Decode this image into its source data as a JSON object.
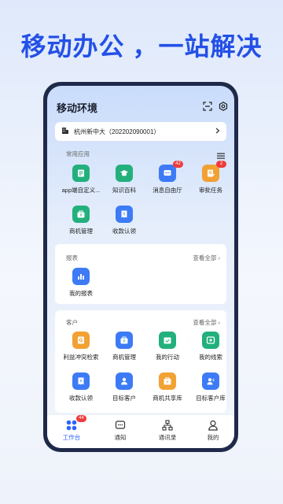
{
  "headline": "移动办公 ，一站解决",
  "app": {
    "title": "移动环境",
    "org": "杭州新中大（202202090001）"
  },
  "common": {
    "title": "常用应用",
    "items": [
      {
        "label": "app端自定义...",
        "color": "#22b07d",
        "icon": "form-icon"
      },
      {
        "label": "知识百科",
        "color": "#22b07d",
        "icon": "graduation-cap-icon"
      },
      {
        "label": "消息自由厅",
        "color": "#3d7bf6",
        "icon": "chat-icon",
        "badge": "42"
      },
      {
        "label": "审批任务",
        "color": "#f2a133",
        "icon": "document-edit-icon",
        "badge": "2"
      },
      {
        "label": "商机管理",
        "color": "#22b07d",
        "icon": "money-bag-icon"
      },
      {
        "label": "收款认领",
        "color": "#3d7bf6",
        "icon": "receipt-icon"
      }
    ]
  },
  "reports": {
    "title": "报表",
    "see_all": "查看全部",
    "items": [
      {
        "label": "我的报表",
        "color": "#3d7bf6",
        "icon": "bar-chart-icon"
      }
    ]
  },
  "customers": {
    "title": "客户",
    "see_all": "查看全部",
    "items": [
      {
        "label": "利益冲突检索",
        "color": "#f2a133",
        "icon": "search-doc-icon"
      },
      {
        "label": "商机管理",
        "color": "#3d7bf6",
        "icon": "money-bag-icon"
      },
      {
        "label": "我的行动",
        "color": "#22b07d",
        "icon": "calendar-check-icon"
      },
      {
        "label": "我的线索",
        "color": "#22b07d",
        "icon": "clue-icon"
      },
      {
        "label": "收款认领",
        "color": "#3d7bf6",
        "icon": "receipt-icon"
      },
      {
        "label": "目标客户",
        "color": "#3d7bf6",
        "icon": "target-user-icon"
      },
      {
        "label": "商机共享库",
        "color": "#f2a133",
        "icon": "share-lib-icon"
      },
      {
        "label": "目标客户库",
        "color": "#3d7bf6",
        "icon": "customer-lib-icon"
      }
    ]
  },
  "tabbar": {
    "tabs": [
      {
        "label": "工作台",
        "badge": "44"
      },
      {
        "label": "通知"
      },
      {
        "label": "通讯录"
      },
      {
        "label": "我的"
      }
    ]
  }
}
